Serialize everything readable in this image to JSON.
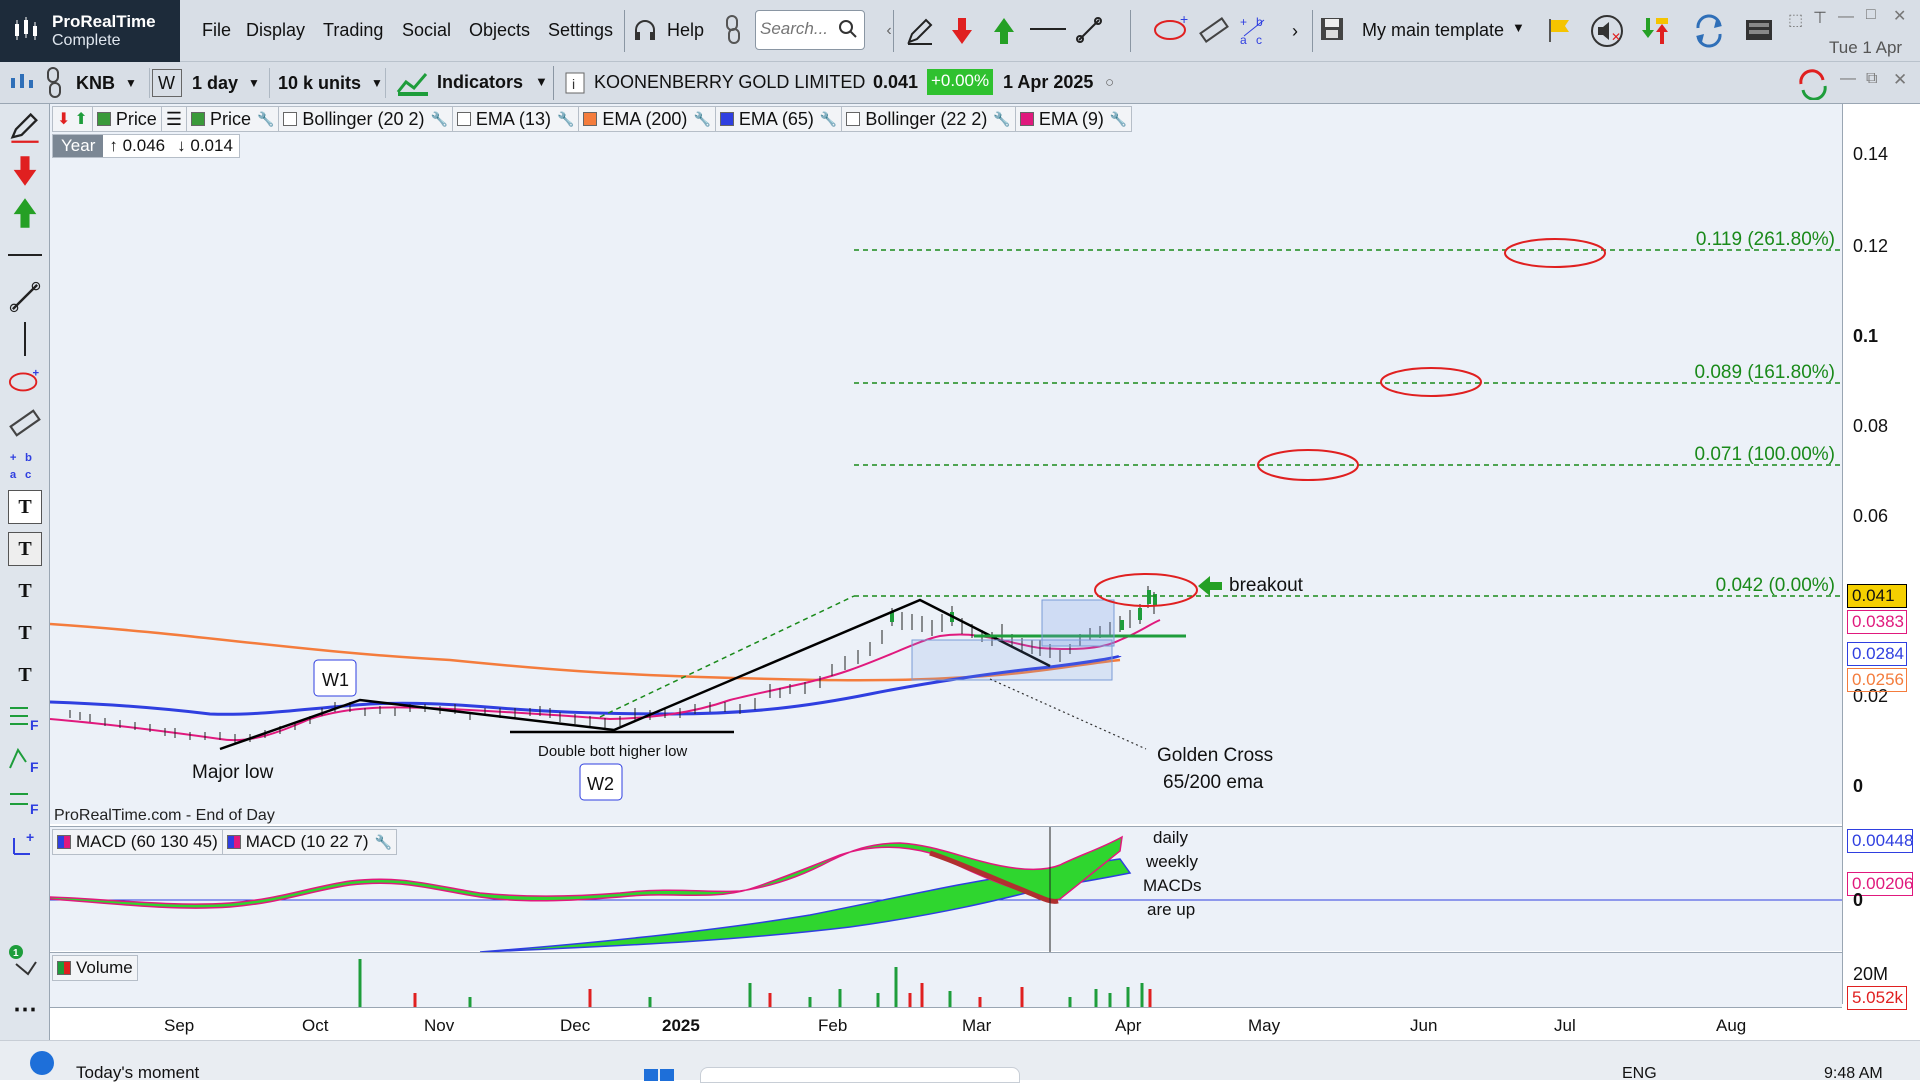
{
  "app": {
    "name": "ProRealTime",
    "edition": "Complete"
  },
  "menu": [
    "File",
    "Display",
    "Trading",
    "Social",
    "Objects",
    "Settings",
    "Help"
  ],
  "search": {
    "placeholder": "Search..."
  },
  "template": {
    "label": "My main template"
  },
  "clock_top": "Tue 1 Apr",
  "toolbar2": {
    "ticker": "KNB",
    "interval_type": "W",
    "interval": "1 day",
    "units": "10 k units",
    "indicators": "Indicators",
    "instrument": "KOONENBERRY GOLD LIMITED",
    "last": "0.041",
    "change": "+0.00%",
    "date": "1 Apr 2025"
  },
  "legend": [
    {
      "label": "Price",
      "color": "#3a9a3a"
    },
    {
      "label": "Price",
      "color": "#3a9a3a"
    },
    {
      "label": "Bollinger (20 2)",
      "color": "#ffffff"
    },
    {
      "label": "EMA (13)",
      "color": "#ffffff"
    },
    {
      "label": "EMA (200)",
      "color": "#f47c3c"
    },
    {
      "label": "EMA (65)",
      "color": "#2f3fe0"
    },
    {
      "label": "Bollinger (22 2)",
      "color": "#ffffff"
    },
    {
      "label": "EMA (9)",
      "color": "#e0197d"
    }
  ],
  "year_box": {
    "label": "Year",
    "high": "0.046",
    "low": "0.014"
  },
  "annotations": {
    "fib": [
      "0.119 (261.80%)",
      "0.089 (161.80%)",
      "0.071 (100.00%)",
      "0.042 (0.00%)"
    ],
    "breakout": "breakout",
    "w1": "W1",
    "w2": "W2",
    "major_low": "Major low",
    "double_bott": "Double bott higher low",
    "golden_cross_1": "Golden Cross",
    "golden_cross_2": "65/200 ema",
    "macd_note": [
      "daily",
      "weekly",
      "MACDs",
      "are up"
    ],
    "source": "ProRealTime.com - End of Day"
  },
  "yaxis": {
    "labels": [
      "0.14",
      "0.12",
      "0.1",
      "0.08",
      "0.06",
      "0.02",
      "0"
    ],
    "tags": [
      {
        "value": "0.041",
        "bg": "#f5d000",
        "color": "#000"
      },
      {
        "value": "0.0383",
        "bg": "#ffffff",
        "color": "#e0197d"
      },
      {
        "value": "0.0284",
        "bg": "#ffffff",
        "color": "#2f3fe0"
      },
      {
        "value": "0.0256",
        "bg": "#ffffff",
        "color": "#f47c3c"
      }
    ]
  },
  "macd_panel": {
    "legend": [
      "MACD (60 130 45)",
      "MACD (10 22 7)"
    ],
    "zero": "0",
    "tags": [
      {
        "value": "0.00448",
        "color": "#2f3fe0"
      },
      {
        "value": "0.00206",
        "color": "#e0197d"
      }
    ]
  },
  "volume_panel": {
    "legend": "Volume",
    "labels": [
      "20M"
    ],
    "tag": "5.052k"
  },
  "xaxis": [
    "Sep",
    "Oct",
    "Nov",
    "Dec",
    "2025",
    "Feb",
    "Mar",
    "Apr",
    "May",
    "Jun",
    "Jul",
    "Aug"
  ],
  "taskbar": {
    "left": "Today's moment",
    "lang": "ENG",
    "time": "9:48 AM"
  },
  "colors": {
    "accent_green": "#1e9d3b",
    "fib_line": "#1a8a1a",
    "chart_bg": "#ecf1f8"
  }
}
